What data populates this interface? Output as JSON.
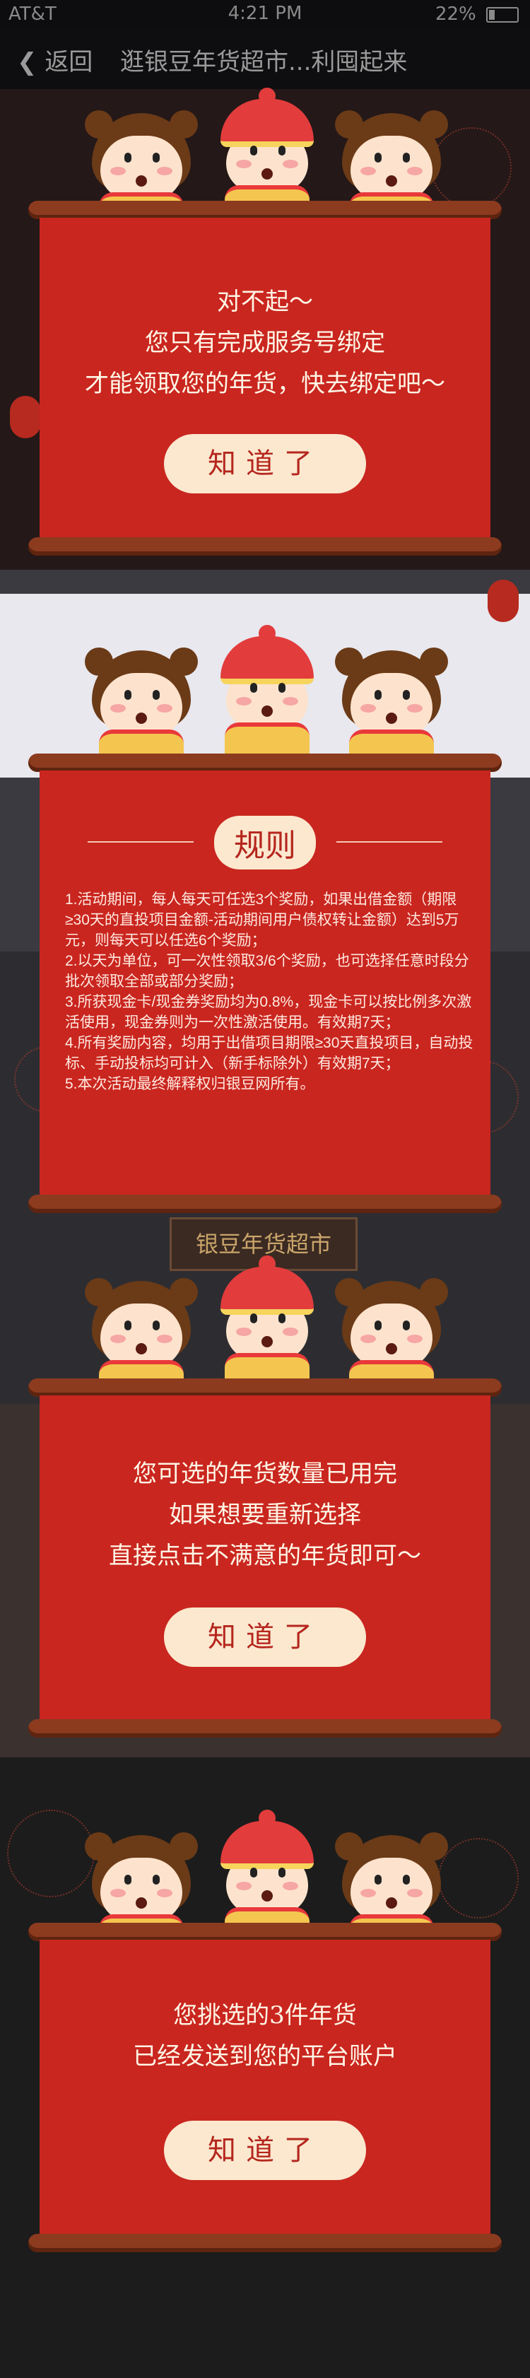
{
  "status_bar": {
    "carrier": "AT&T",
    "time": "4:21 PM",
    "battery": "22%"
  },
  "nav": {
    "back_label": "返回",
    "title": "逛银豆年货超市...利囤起来"
  },
  "scene": {
    "shop_sign": "银豆年货超市"
  },
  "modal_bind": {
    "lines": [
      "对不起～",
      "您只有完成服务号绑定",
      "才能领取您的年货，快去绑定吧～"
    ],
    "button": "知道了"
  },
  "modal_rules": {
    "title": "规则",
    "items": [
      "1.活动期间，每人每天可任选3个奖励，如果出借金额（期限≥30天的直投项目金额-活动期间用户债权转让金额）达到5万元，则每天可以任选6个奖励；",
      "2.以天为单位，可一次性领取3/6个奖励，也可选择任意时段分批次领取全部或部分奖励；",
      "3.所获现金卡/现金券奖励均为0.8%，现金卡可以按比例多次激活使用，现金券则为一次性激活使用。有效期7天；",
      "4.所有奖励内容，均用于出借项目期限≥30天直投项目，自动投标、手动投标均可计入（新手标除外）有效期7天；",
      "5.本次活动最终解释权归银豆网所有。"
    ]
  },
  "modal_limit": {
    "lines": [
      "您可选的年货数量已用完",
      "如果想要重新选择",
      "直接点击不满意的年货即可～"
    ],
    "button": "知道了"
  },
  "modal_sent": {
    "lines": [
      "您挑选的3件年货",
      "已经发送到您的平台账户"
    ],
    "button": "知道了"
  },
  "colors": {
    "panel_red": "#c9261f",
    "scroll_brown": "#8c3b1f",
    "button_cream": "#fbe8cf"
  }
}
